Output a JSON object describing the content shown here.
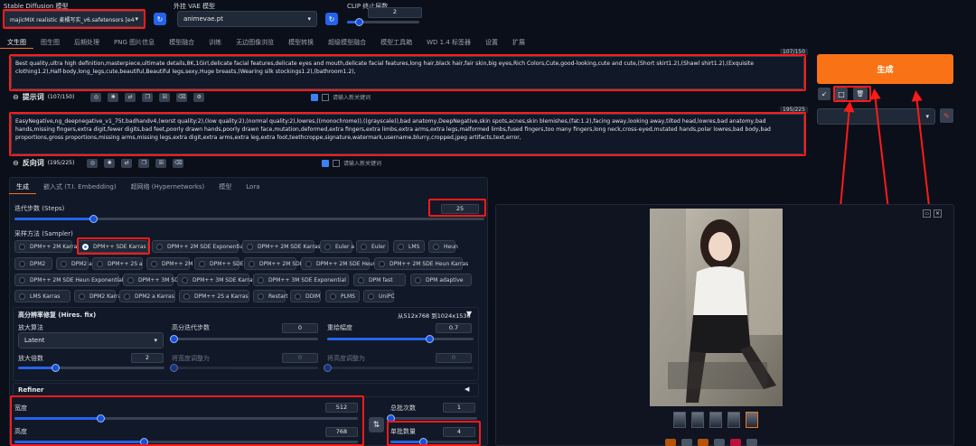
{
  "header": {
    "model_label": "Stable Diffusion 模型",
    "model_value": "majicMIX realistic 麦橘写实_v6.safetensors [e4c",
    "vae_label": "外挂 VAE 模型",
    "vae_value": "animevae.pt",
    "clip_label": "CLIP 终止层数",
    "clip_value": "2",
    "clip_level": 0.167
  },
  "tabs": [
    "文生图",
    "图生图",
    "后期处理",
    "PNG 图片信息",
    "模型融合",
    "训练",
    "无边图像浏览",
    "模型转换",
    "超级模型融合",
    "模型工具箱",
    "WD 1.4 标签器",
    "设置",
    "扩展"
  ],
  "prompt": {
    "counter": "107/150",
    "text": "Best quality,ultra high definition,masterpiece,ultimate details,8K,1Girl,delicate facial features,delicate eyes and mouth,delicate facial features,long hair,black hair,fair skin,big eyes,Rich Colors,Cute,good-looking,cute and cute,(Short skirt1.2),(Shawl shirt1.2),(Exquisite clothing1.2),Half-body,long_legs,cute,beautiful,Beautiful legs,sexy,Huge breasts,(Wearing silk stockings1.2),(bathroom1.2),",
    "label": "提示词",
    "label_count": "(107/150)",
    "input_hint": "请输入新关键词"
  },
  "negative": {
    "counter": "195/225",
    "text": "EasyNegative,ng_deepnegative_v1_75t,badhandv4,(worst quality:2),(low quality:2),(normal quality:2),lowres,((monochrome)),((grayscale)),bad anatomy,DeepNegative,skin spots,acnes,skin blemishes,(fat:1.2),facing away,looking away,tilted head,lowres,bad anatomy,bad hands,missing fingers,extra digit,fewer digits,bad feet,poorly drawn hands,poorly drawn face,mutation,deformed,extra fingers,extra limbs,extra arms,extra legs,malformed limbs,fused fingers,too many fingers,long neck,cross-eyed,mutated hands,polar lowres,bad body,bad proportions,gross proportions,missing arms,missing legs,extra digit,extra arms,extra leg,extra foot,teethcroppe,signature,watermark,username,blurry,cropped,jpeg artifacts,text,error,",
    "label": "反向词",
    "label_count": "(195/225)",
    "input_hint": "请输入新关键词"
  },
  "generate_button": "生成",
  "subtabs": [
    "生成",
    "嵌入式 (T.I. Embedding)",
    "超网络 (Hypernetworks)",
    "模型",
    "Lora"
  ],
  "steps": {
    "label": "迭代步数 (Steps)",
    "value": "25",
    "level": 0.167
  },
  "sampler": {
    "label": "采样方法 (Sampler)",
    "rows": [
      [
        "DPM++ 2M Karras",
        "DPM++ SDE Karras",
        "DPM++ 2M SDE Exponential",
        "DPM++ 2M SDE Karras",
        "Euler a",
        "Euler",
        "LMS",
        "Heun"
      ],
      [
        "DPM2",
        "DPM2 a",
        "DPM++ 2S a",
        "DPM++ 2M",
        "DPM++ SDE",
        "DPM++ 2M SDE",
        "DPM++ 2M SDE Heun",
        "DPM++ 2M SDE Heun Karras"
      ],
      [
        "DPM++ 2M SDE Heun Exponential",
        "DPM++ 3M SDE",
        "DPM++ 3M SDE Karras",
        "DPM++ 3M SDE Exponential",
        "DPM fast",
        "DPM adaptive"
      ],
      [
        "LMS Karras",
        "DPM2 Karras",
        "DPM2 a Karras",
        "DPM++ 2S a Karras",
        "Restart",
        "DDIM",
        "PLMS",
        "UniPC"
      ]
    ],
    "selected": "DPM++ SDE Karras"
  },
  "hires": {
    "title": "高分辨率修复 (Hires. fix)",
    "resolution": "从512x768 到1024x1536",
    "upscaler_label": "放大算法",
    "upscaler_value": "Latent",
    "hires_steps_label": "高分迭代步数",
    "hires_steps_value": "0",
    "denoise_label": "重绘幅度",
    "denoise_value": "0.7",
    "denoise_level": 0.7,
    "scale_label": "放大倍数",
    "scale_value": "2",
    "scale_level": 0.25,
    "width_label": "将宽度调整为",
    "width_value": "0",
    "height_label": "将高度调整为",
    "height_value": "0"
  },
  "refiner": {
    "label": "Refiner"
  },
  "width": {
    "label": "宽度",
    "value": "512",
    "level": 0.25
  },
  "height": {
    "label": "高度",
    "value": "768",
    "level": 0.375
  },
  "batch_count": {
    "label": "总批次数",
    "value": "1",
    "level": 0.0
  },
  "batch_size": {
    "label": "单批数量",
    "value": "4",
    "level": 0.375
  },
  "swap_icon": "⇅",
  "icons": {
    "refresh": "refresh-icon",
    "pencil": "pencil-icon",
    "stop": "square-icon",
    "trash": "trash-icon",
    "brush": "brush-icon"
  },
  "colors": {
    "accent": "#f97316",
    "highlight": "#ff1a1a",
    "primary": "#2563eb",
    "bg": "#0b0f19"
  }
}
